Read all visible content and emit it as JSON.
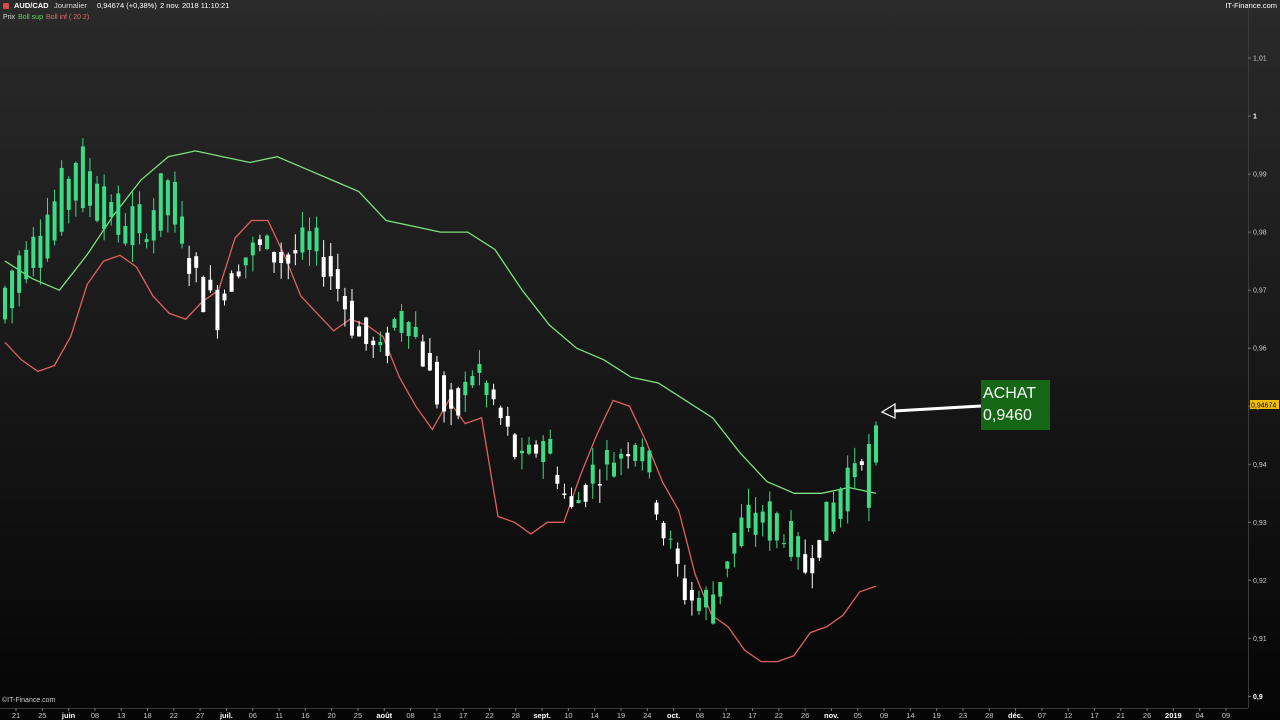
{
  "header": {
    "symbol": "AUD/CAD",
    "period": "Journalier",
    "price_change": "0,94674 (+0,38%)",
    "datetime": "2 nov. 2018 11:10:21",
    "site": "IT-Finance.com"
  },
  "legend": {
    "prix": "Prix",
    "boll_sup": "Boll sup",
    "boll_inf": "Boll inf ( 20 2)"
  },
  "copyright": "©IT-Finance.com",
  "colors": {
    "up_candle": "#3ddc84",
    "down_candle": "#ffffff",
    "boll_sup": "#7ee07e",
    "boll_inf": "#e06060",
    "annotation_bg": "#156615",
    "last_price_bg": "#f0c000"
  },
  "chart_data": {
    "type": "candlestick",
    "ylim": [
      0.898,
      1.02
    ],
    "y_ticks": [
      "1,01",
      "1",
      "0,99",
      "0,98",
      "0,97",
      "0,96",
      "0,95",
      "0,94",
      "0,93",
      "0,92",
      "0,91",
      "0,9"
    ],
    "y_tick_values": [
      1.01,
      1.0,
      0.99,
      0.98,
      0.97,
      0.96,
      0.95,
      0.94,
      0.93,
      0.92,
      0.91,
      0.9
    ],
    "bold_y_ticks": [
      "1",
      "0,95",
      "0,9"
    ],
    "x_ticks": [
      "21",
      "25",
      "juin",
      "08",
      "13",
      "18",
      "22",
      "27",
      "juil.",
      "06",
      "11",
      "16",
      "20",
      "25",
      "août",
      "08",
      "13",
      "17",
      "22",
      "28",
      "sept.",
      "10",
      "14",
      "19",
      "24",
      "oct.",
      "08",
      "12",
      "17",
      "22",
      "26",
      "nov.",
      "05",
      "09",
      "14",
      "19",
      "23",
      "28",
      "déc.",
      "07",
      "12",
      "17",
      "21",
      "26",
      "2019",
      "04",
      "09"
    ],
    "bold_x_ticks": [
      "juin",
      "juil.",
      "août",
      "sept.",
      "oct.",
      "nov.",
      "déc.",
      "2019"
    ],
    "last_price_label": "0,94674",
    "annotation": {
      "text_line1": "ACHAT",
      "text_line2": "0,9460",
      "price": 0.946
    },
    "anchors": [
      [
        0.965,
        0.97
      ],
      [
        0.972,
        0.981
      ],
      [
        0.978,
        0.984
      ],
      [
        0.986,
        0.993
      ],
      [
        0.983,
        0.99
      ],
      [
        0.979,
        0.983
      ],
      [
        0.978,
        0.982
      ],
      [
        0.983,
        0.99
      ],
      [
        0.976,
        0.972
      ],
      [
        0.97,
        0.966
      ],
      [
        0.973,
        0.976
      ],
      [
        0.979,
        0.977
      ],
      [
        0.976,
        0.975
      ],
      [
        0.977,
        0.979
      ],
      [
        0.975,
        0.972
      ],
      [
        0.965,
        0.962
      ],
      [
        0.961,
        0.958
      ],
      [
        0.963,
        0.97
      ],
      [
        0.961,
        0.955
      ],
      [
        0.951,
        0.946
      ],
      [
        0.955,
        0.958
      ],
      [
        0.95,
        0.948
      ],
      [
        0.942,
        0.939
      ],
      [
        0.942,
        0.946
      ],
      [
        0.934,
        0.931
      ],
      [
        0.937,
        0.939
      ],
      [
        0.94,
        0.942
      ],
      [
        0.943,
        0.946
      ],
      [
        0.931,
        0.928
      ],
      [
        0.919,
        0.917
      ],
      [
        0.913,
        0.917
      ],
      [
        0.925,
        0.928
      ],
      [
        0.929,
        0.933
      ],
      [
        0.927,
        0.93
      ],
      [
        0.924,
        0.922
      ],
      [
        0.928,
        0.931
      ],
      [
        0.935,
        0.941
      ],
      [
        0.947,
        0.9467
      ]
    ],
    "boll_sup_anchors": [
      [
        0.975,
        0.972,
        0.97,
        0.976,
        0.983,
        0.989,
        0.993,
        0.994,
        0.993,
        0.992,
        0.993,
        0.991,
        0.989,
        0.987,
        0.982,
        0.981,
        0.98,
        0.98,
        0.977,
        0.97,
        0.964,
        0.96,
        0.958,
        0.955,
        0.954,
        0.951,
        0.948,
        0.942,
        0.937,
        0.935,
        0.935,
        0.936,
        0.935
      ]
    ],
    "boll_inf_anchors": [
      [
        0.961,
        0.958,
        0.956,
        0.957,
        0.962,
        0.971,
        0.975,
        0.976,
        0.974,
        0.969,
        0.966,
        0.965,
        0.968,
        0.97,
        0.979,
        0.982,
        0.982,
        0.976,
        0.969,
        0.966,
        0.963,
        0.965,
        0.964,
        0.962,
        0.955,
        0.95,
        0.946,
        0.951,
        0.947,
        0.948,
        0.931,
        0.93,
        0.928,
        0.93,
        0.93,
        0.938,
        0.945,
        0.951,
        0.95,
        0.944,
        0.937,
        0.932,
        0.921,
        0.914,
        0.912,
        0.908,
        0.906,
        0.906,
        0.907,
        0.911,
        0.912,
        0.914,
        0.918,
        0.919
      ]
    ]
  }
}
